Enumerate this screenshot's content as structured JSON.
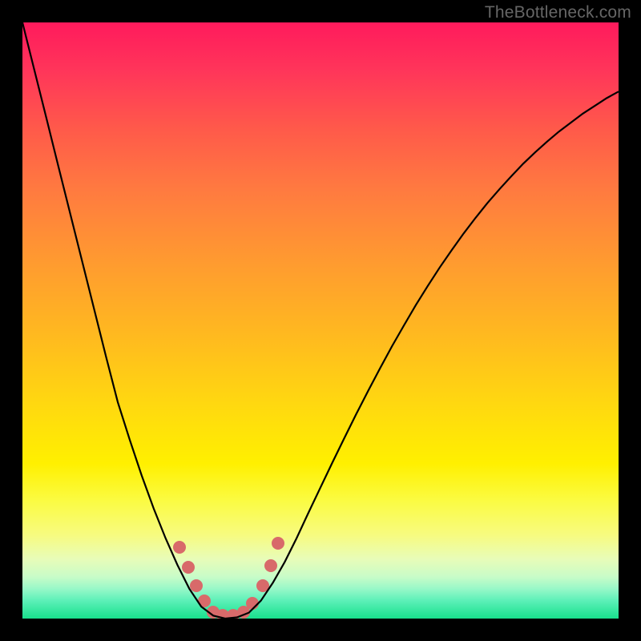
{
  "watermark": "TheBottleneck.com",
  "chart_data": {
    "type": "line",
    "title": "",
    "xlabel": "",
    "ylabel": "",
    "xlim": [
      0,
      1
    ],
    "ylim": [
      0,
      1
    ],
    "x": [
      0.0,
      0.02,
      0.04,
      0.06,
      0.08,
      0.1,
      0.12,
      0.14,
      0.16,
      0.18,
      0.2,
      0.22,
      0.24,
      0.26,
      0.28,
      0.3,
      0.32,
      0.34,
      0.36,
      0.38,
      0.4,
      0.42,
      0.44,
      0.46,
      0.48,
      0.5,
      0.52,
      0.54,
      0.56,
      0.58,
      0.6,
      0.62,
      0.64,
      0.66,
      0.68,
      0.7,
      0.72,
      0.74,
      0.76,
      0.78,
      0.8,
      0.82,
      0.84,
      0.86,
      0.88,
      0.9,
      0.92,
      0.94,
      0.96,
      0.98,
      1.0
    ],
    "y": [
      1.0,
      0.92,
      0.84,
      0.76,
      0.68,
      0.6,
      0.52,
      0.44,
      0.363,
      0.3,
      0.24,
      0.185,
      0.135,
      0.09,
      0.05,
      0.02,
      0.005,
      0.0,
      0.002,
      0.01,
      0.03,
      0.06,
      0.095,
      0.135,
      0.178,
      0.22,
      0.262,
      0.303,
      0.343,
      0.382,
      0.42,
      0.457,
      0.492,
      0.526,
      0.558,
      0.589,
      0.618,
      0.646,
      0.672,
      0.697,
      0.72,
      0.742,
      0.763,
      0.782,
      0.8,
      0.817,
      0.832,
      0.847,
      0.86,
      0.873,
      0.884
    ],
    "annotations": [
      {
        "kind": "marker-cluster",
        "x_range": [
          0.26,
          0.41
        ],
        "y_range": [
          0.0,
          0.14
        ],
        "color": "#d86a6a"
      }
    ],
    "gradient": "red-to-green vertical"
  }
}
